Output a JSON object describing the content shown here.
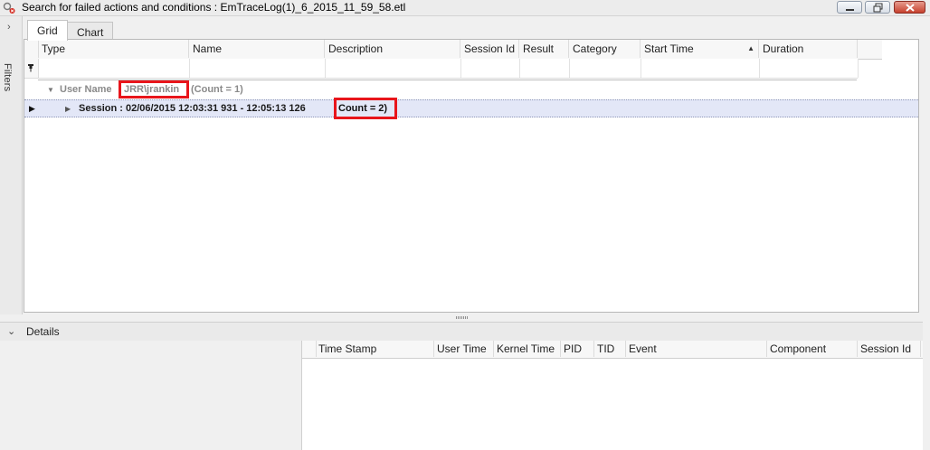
{
  "window": {
    "title": "Search for failed actions and conditions : EmTraceLog(1)_6_2015_11_59_58.etl",
    "app_icon": "search-error-icon",
    "controls": [
      "minimize-icon",
      "maximize-icon",
      "close-icon"
    ]
  },
  "filters_panel": {
    "label": "Filters",
    "expand_icon": "chevron-right-icon"
  },
  "tabs": [
    {
      "label": "Grid",
      "active": true
    },
    {
      "label": "Chart",
      "active": false
    }
  ],
  "grid": {
    "columns": [
      {
        "label": "Type"
      },
      {
        "label": "Name"
      },
      {
        "label": "Description"
      },
      {
        "label": "Session Id"
      },
      {
        "label": "Result"
      },
      {
        "label": "Category"
      },
      {
        "label": "Start Time",
        "sorted": "ascending"
      },
      {
        "label": "Duration"
      }
    ],
    "filter_row_icon": "pin-icon",
    "group_row": {
      "label": "User Name",
      "value": "JRR\\jrankin",
      "count": "(Count = 1)"
    },
    "session_row": {
      "text": "Session : 02/06/2015 12:03:31 931 - 12:05:13 126",
      "count": "Count = 2)"
    }
  },
  "details": {
    "title": "Details",
    "collapse_icon": "chevron-down-icon",
    "columns": [
      {
        "label": "Time Stamp"
      },
      {
        "label": "User Time"
      },
      {
        "label": "Kernel Time"
      },
      {
        "label": "PID"
      },
      {
        "label": "TID"
      },
      {
        "label": "Event"
      },
      {
        "label": "Component"
      },
      {
        "label": "Session Id"
      }
    ]
  },
  "colors": {
    "highlight": "#e8151b",
    "selected_row": "#e3e7f7",
    "group_text": "#8a8a8a"
  }
}
